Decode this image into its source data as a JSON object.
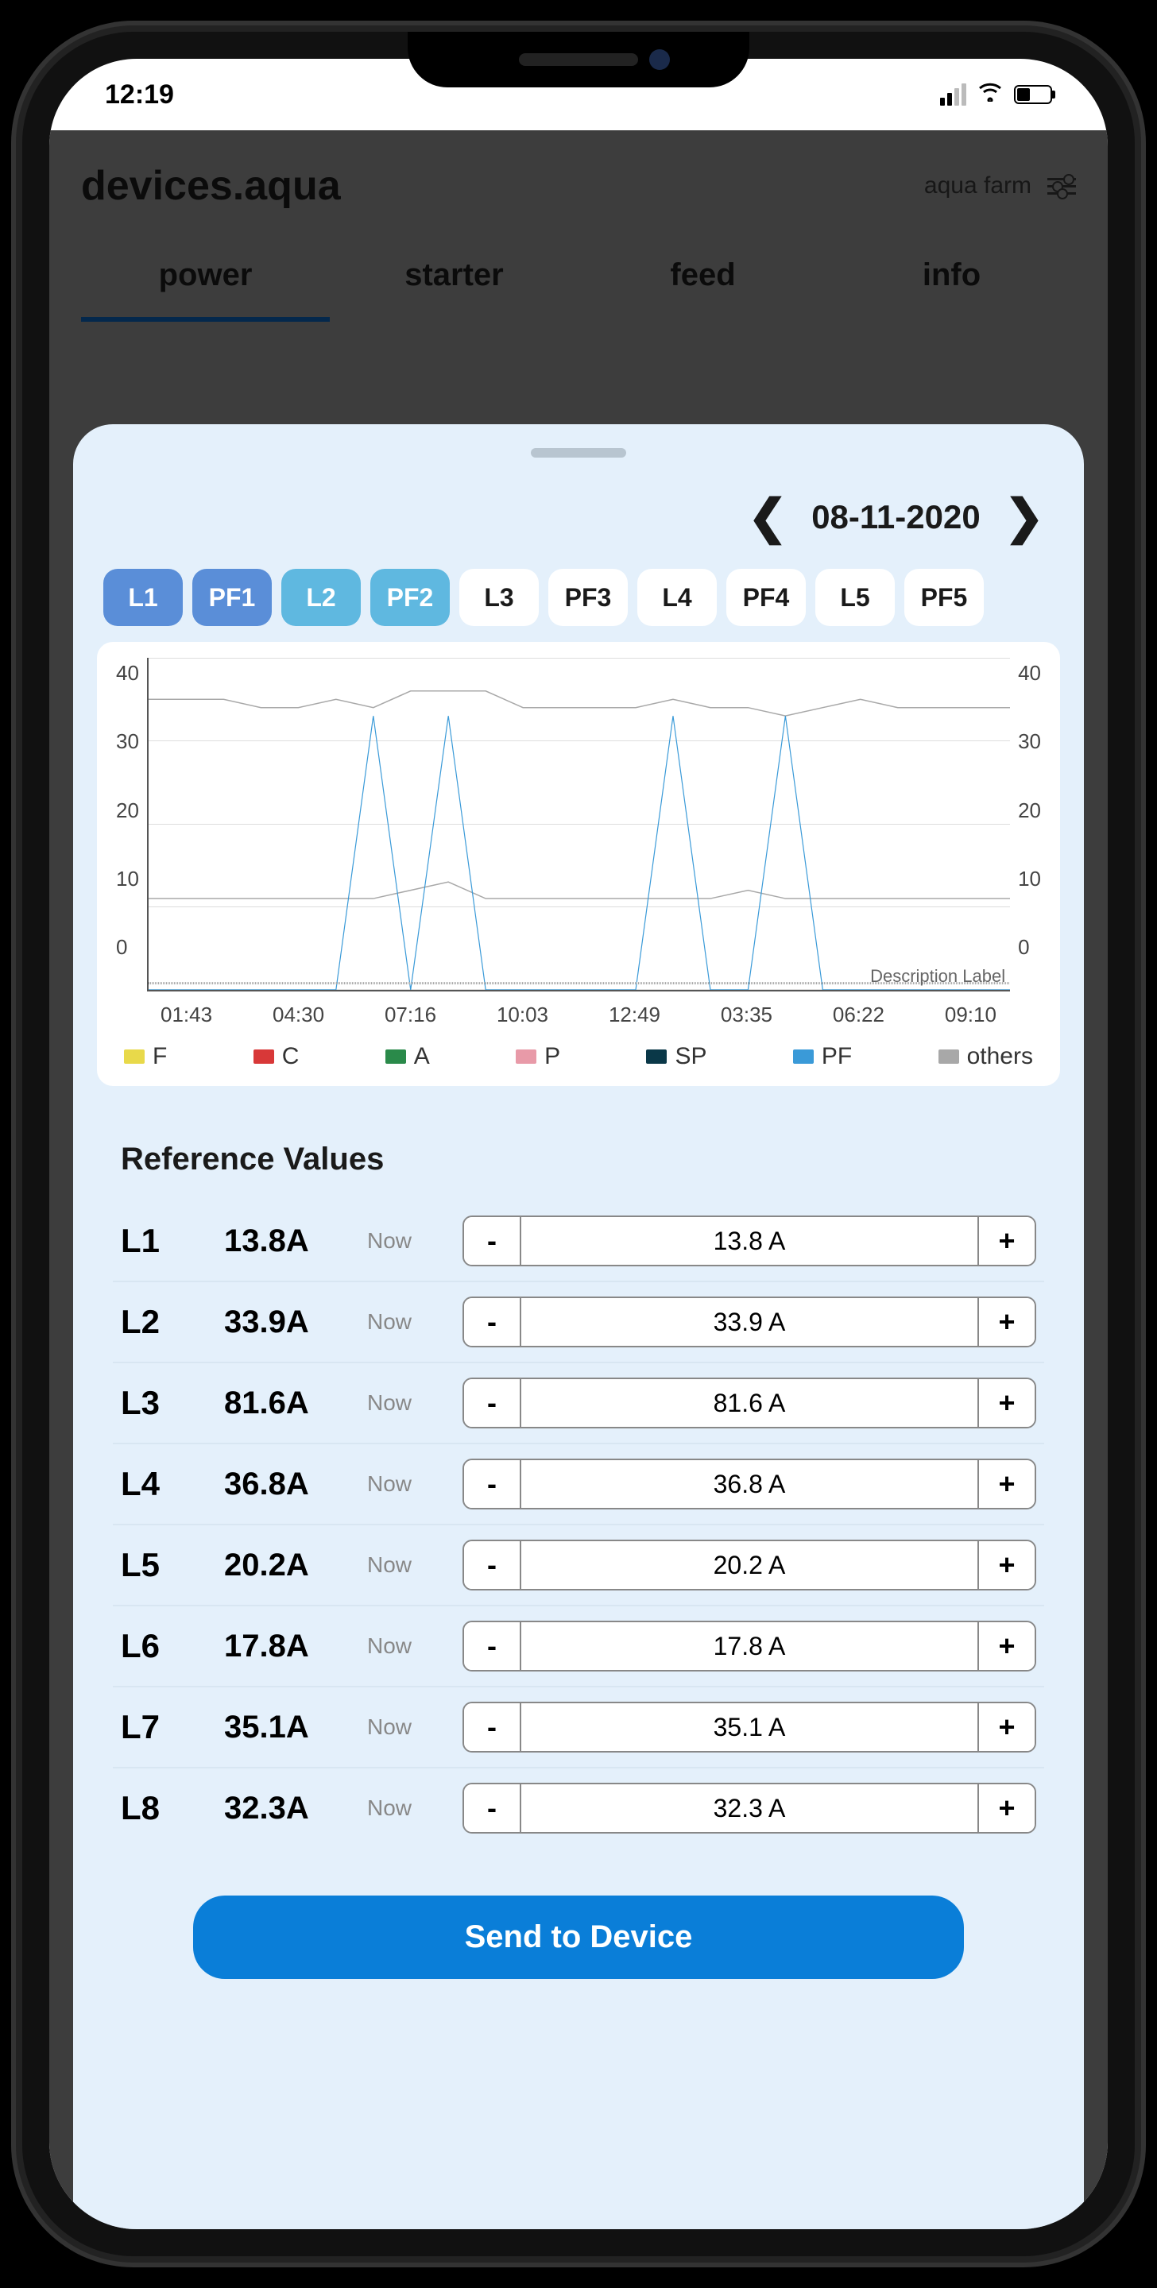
{
  "status_bar": {
    "time": "12:19"
  },
  "header": {
    "title": "devices.aqua",
    "farm": "aqua farm"
  },
  "tabs": [
    "power",
    "starter",
    "feed",
    "info"
  ],
  "active_tab": 0,
  "sheet": {
    "date": "08-11-2020",
    "chips": [
      {
        "label": "L1",
        "style": "blue1"
      },
      {
        "label": "PF1",
        "style": "blue1"
      },
      {
        "label": "L2",
        "style": "blue2"
      },
      {
        "label": "PF2",
        "style": "blue2"
      },
      {
        "label": "L3",
        "style": "white"
      },
      {
        "label": "PF3",
        "style": "white"
      },
      {
        "label": "L4",
        "style": "white"
      },
      {
        "label": "PF4",
        "style": "white"
      },
      {
        "label": "L5",
        "style": "white"
      },
      {
        "label": "PF5",
        "style": "white"
      }
    ],
    "chart_data": {
      "type": "line",
      "ylim": [
        0,
        40
      ],
      "x_ticks": [
        "01:43",
        "04:30",
        "07:16",
        "10:03",
        "12:49",
        "03:35",
        "06:22",
        "09:10"
      ],
      "y_ticks": [
        "40",
        "30",
        "20",
        "10",
        "0"
      ],
      "description_label": "Description Label",
      "legend": [
        {
          "name": "F",
          "color": "#e8d94a"
        },
        {
          "name": "C",
          "color": "#d83838"
        },
        {
          "name": "A",
          "color": "#2a8a4a"
        },
        {
          "name": "P",
          "color": "#e89aa8"
        },
        {
          "name": "SP",
          "color": "#0a3848"
        },
        {
          "name": "PF",
          "color": "#3a9ad8"
        },
        {
          "name": "others",
          "color": "#a8a8a8"
        }
      ],
      "series": [
        {
          "name": "upper_gray",
          "color": "#a8a8a8",
          "values": [
            35,
            35,
            35,
            34,
            34,
            35,
            34,
            36,
            36,
            36,
            34,
            34,
            34,
            34,
            35,
            34,
            34,
            33,
            34,
            35,
            34,
            34,
            34,
            34
          ]
        },
        {
          "name": "lower_gray",
          "color": "#a8a8a8",
          "values": [
            11,
            11,
            11,
            11,
            11,
            11,
            11,
            12,
            13,
            11,
            11,
            11,
            11,
            11,
            11,
            11,
            12,
            11,
            11,
            11,
            11,
            11,
            11,
            11
          ]
        },
        {
          "name": "PF_blue",
          "color": "#3a9ad8",
          "values": [
            0,
            0,
            0,
            0,
            0,
            0,
            33,
            0,
            33,
            0,
            0,
            0,
            0,
            0,
            33,
            0,
            0,
            33,
            0,
            0,
            0,
            0,
            0,
            0
          ]
        }
      ]
    },
    "reference_title": "Reference Values",
    "now_label": "Now",
    "reference_values": [
      {
        "label": "L1",
        "current": "13.8A",
        "stepper": "13.8 A"
      },
      {
        "label": "L2",
        "current": "33.9A",
        "stepper": "33.9 A"
      },
      {
        "label": "L3",
        "current": "81.6A",
        "stepper": "81.6 A"
      },
      {
        "label": "L4",
        "current": "36.8A",
        "stepper": "36.8 A"
      },
      {
        "label": "L5",
        "current": "20.2A",
        "stepper": "20.2 A"
      },
      {
        "label": "L6",
        "current": "17.8A",
        "stepper": "17.8 A"
      },
      {
        "label": "L7",
        "current": "35.1A",
        "stepper": "35.1 A"
      },
      {
        "label": "L8",
        "current": "32.3A",
        "stepper": "32.3 A"
      }
    ],
    "send_button": "Send to Device"
  }
}
